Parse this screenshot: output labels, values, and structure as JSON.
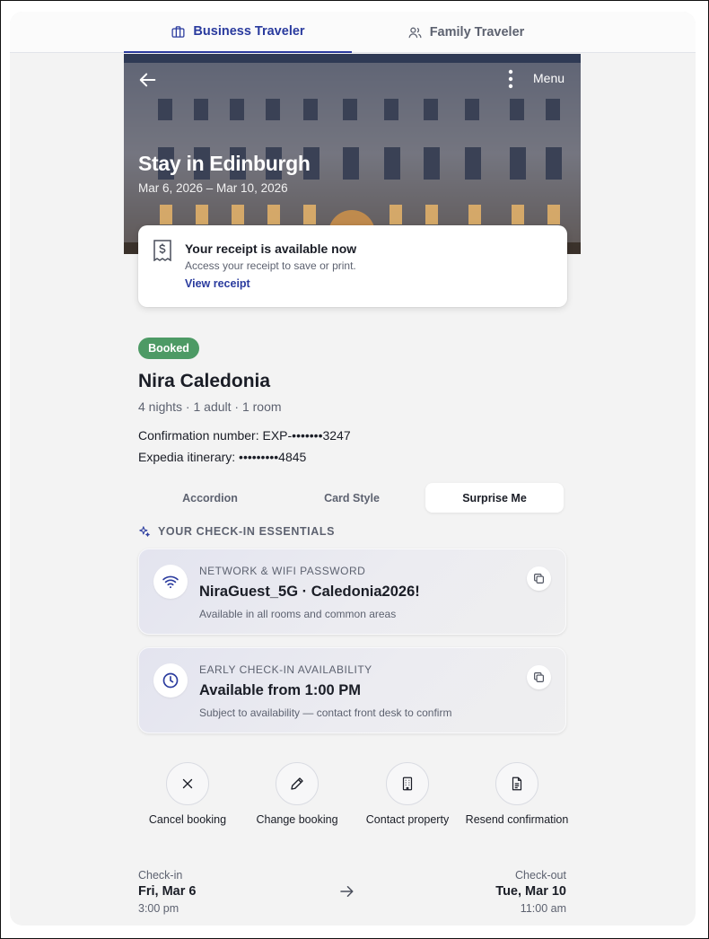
{
  "tabs": [
    {
      "label": "Business Traveler",
      "icon": "briefcase-icon",
      "active": true
    },
    {
      "label": "Family Traveler",
      "icon": "people-icon",
      "active": false
    }
  ],
  "hero": {
    "title": "Stay in Edinburgh",
    "dates": "Mar 6, 2026 – Mar 10, 2026",
    "menu_label": "Menu",
    "back_icon": "arrow-left-icon",
    "kebab_icon": "more-vertical-icon"
  },
  "receipt": {
    "icon": "receipt-icon",
    "title": "Your receipt is available now",
    "subtitle": "Access your receipt to save or print.",
    "link": "View receipt"
  },
  "booking": {
    "status": "Booked",
    "status_color": "#4d9a65",
    "hotel_name": "Nira Caledonia",
    "meta": "4 nights · 1 adult · 1 room",
    "confirmation": "Confirmation number: EXP-•••••••3247",
    "itinerary": "Expedia itinerary: •••••••••4845"
  },
  "view_toggle": {
    "options": [
      "Accordion",
      "Card Style",
      "Surprise Me"
    ],
    "selected": "Surprise Me"
  },
  "essentials": {
    "heading": "YOUR CHECK-IN ESSENTIALS",
    "heading_icon": "sparkle-icon",
    "cards": [
      {
        "icon": "wifi-icon",
        "label": "NETWORK & WIFI PASSWORD",
        "value": "NiraGuest_5G · Caledonia2026!",
        "note": "Available in all rooms and common areas"
      },
      {
        "icon": "clock-icon",
        "label": "EARLY CHECK-IN AVAILABILITY",
        "value": "Available from 1:00 PM",
        "note": "Subject to availability — contact front desk to confirm"
      }
    ]
  },
  "actions": [
    {
      "label": "Cancel booking",
      "icon": "close-icon"
    },
    {
      "label": "Change booking",
      "icon": "pencil-icon"
    },
    {
      "label": "Contact property",
      "icon": "building-icon"
    },
    {
      "label": "Resend confirmation",
      "icon": "document-icon"
    }
  ],
  "dates": {
    "checkin_label": "Check-in",
    "checkin_date": "Fri, Mar 6",
    "checkin_time": "3:00 pm",
    "checkout_label": "Check-out",
    "checkout_date": "Tue, Mar 10",
    "checkout_time": "11:00 am"
  },
  "colors": {
    "accent": "#2a3b9e",
    "success": "#4d9a65",
    "muted": "#5d6270"
  }
}
